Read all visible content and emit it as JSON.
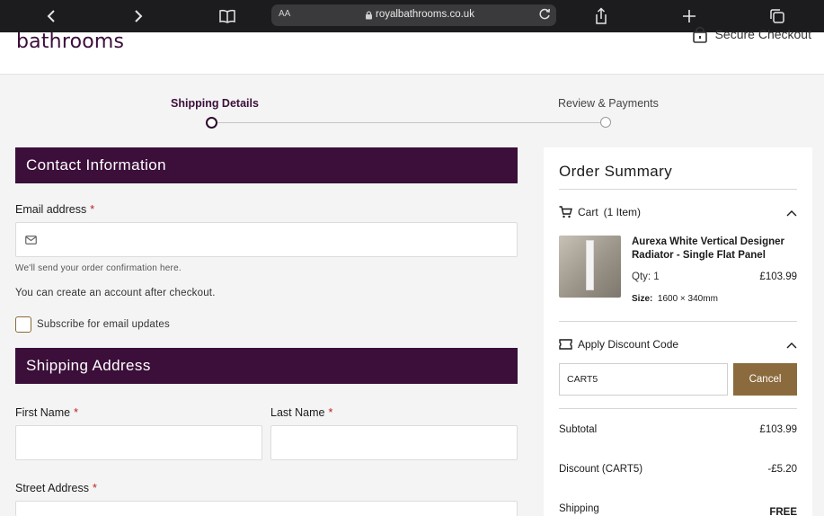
{
  "browser": {
    "text_size_label": "AA",
    "url": "royalbathrooms.co.uk"
  },
  "header": {
    "logo_text": "bathrooms",
    "secure_label": "Secure Checkout"
  },
  "stepper": {
    "steps": [
      "Shipping Details",
      "Review & Payments"
    ],
    "active_step": 1
  },
  "contact": {
    "title": "Contact Information",
    "email_label": "Email address",
    "required_mark": "*",
    "email_value": "",
    "email_hint": "We'll send your order confirmation here.",
    "account_note": "You can create an account after checkout.",
    "subscribe_label": "Subscribe for email updates",
    "subscribe_checked": false
  },
  "shipping": {
    "title": "Shipping Address",
    "first_name_label": "First Name",
    "last_name_label": "Last Name",
    "street_label": "Street Address",
    "first_name_value": "",
    "last_name_value": ""
  },
  "summary": {
    "title": "Order Summary",
    "cart_label": "Cart",
    "cart_count": "(1 Item)",
    "product": {
      "name": "Aurexa White Vertical Designer Radiator - Single Flat Panel",
      "qty": "Qty: 1",
      "price": "£103.99",
      "size_label": "Size:",
      "size_value": "1600 × 340mm"
    },
    "discount_label": "Apply Discount Code",
    "discount_code": "CART5",
    "cancel_label": "Cancel",
    "subtotal_label": "Subtotal",
    "subtotal_value": "£103.99",
    "discount_line_label": "Discount (CART5)",
    "discount_line_value": "-£5.20",
    "shipping_label": "Shipping",
    "shipping_value": "FREE"
  },
  "colors": {
    "brand": "#3b0f3a",
    "accent": "#8b6b3d",
    "required": "#c21c1c"
  }
}
